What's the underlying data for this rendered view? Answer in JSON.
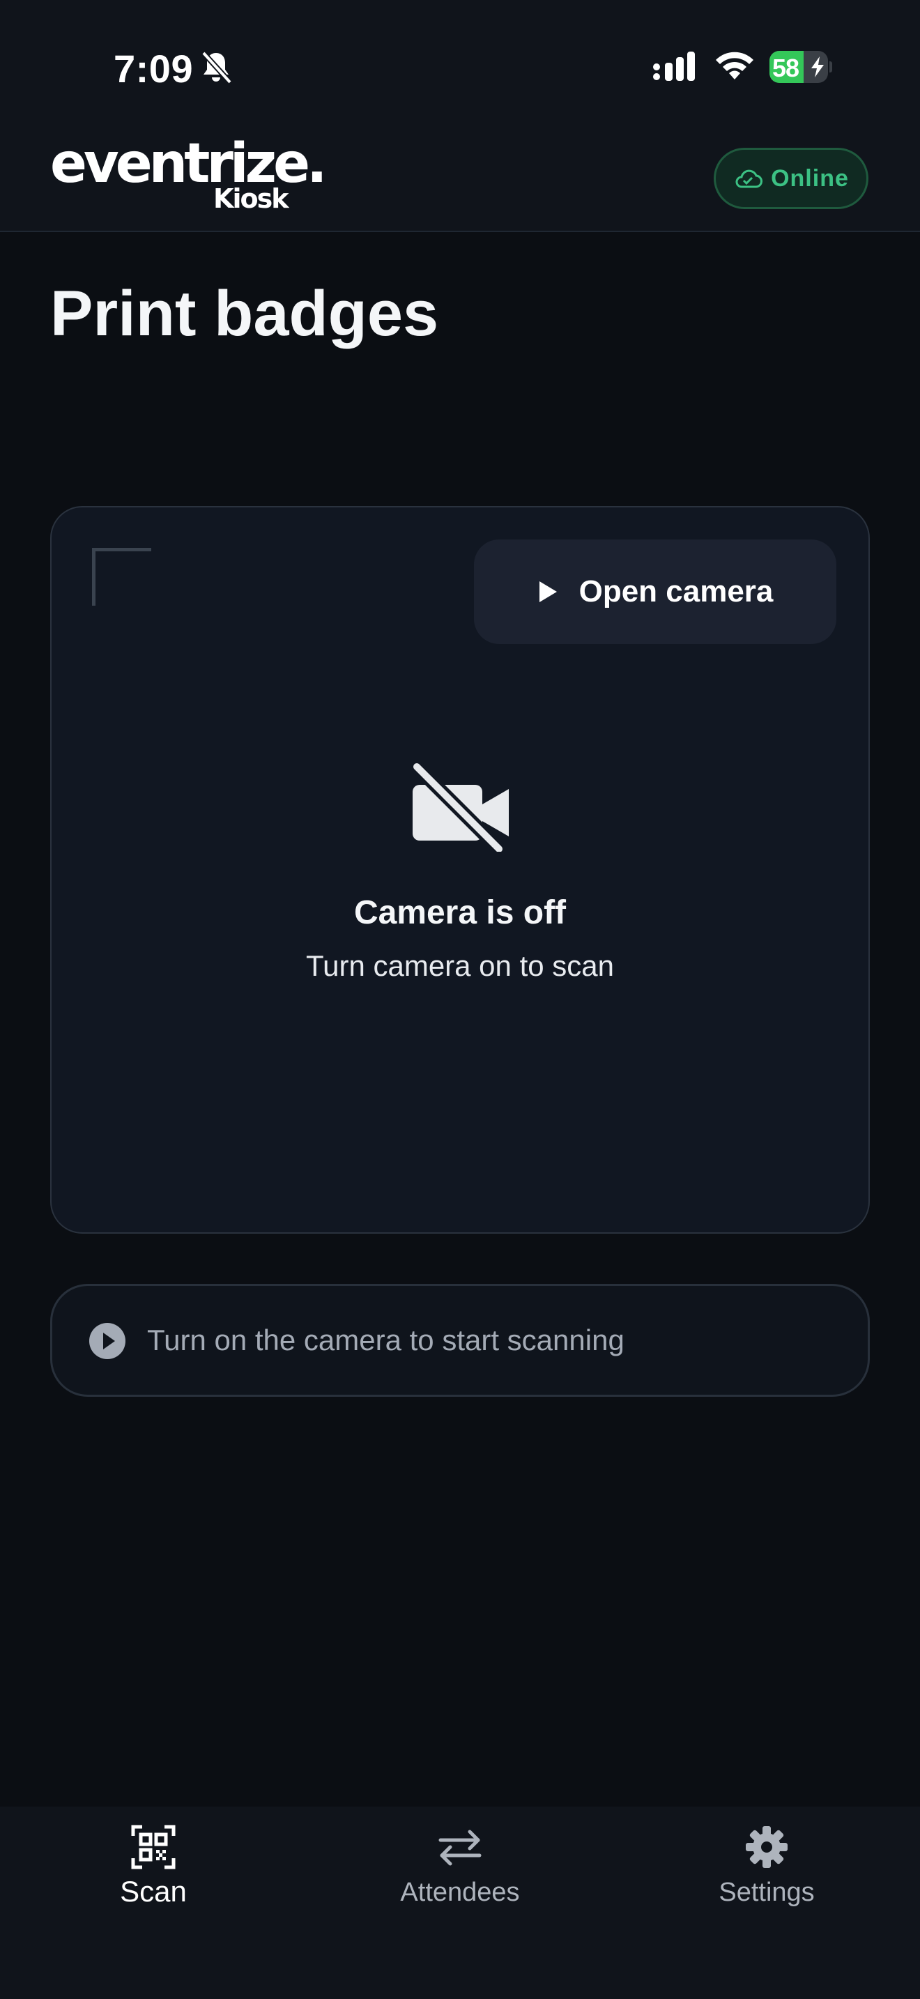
{
  "status_bar": {
    "time": "7:09",
    "battery_level": "58",
    "battery_fraction": 0.58
  },
  "header": {
    "logo_text": "eventrize.",
    "logo_subtext": "Kiosk",
    "connection_status": "Online",
    "status_color": "#3cc184"
  },
  "page": {
    "title": "Print badges"
  },
  "camera": {
    "open_button_label": "Open camera",
    "off_title": "Camera is off",
    "off_subtitle": "Turn camera on to scan"
  },
  "info_bar": {
    "message": "Turn on the camera to start scanning",
    "icon": "play-circle-icon"
  },
  "bottom_nav": {
    "items": [
      {
        "label": "Scan",
        "icon": "qr-code-icon",
        "active": true
      },
      {
        "label": "Attendees",
        "icon": "swap-arrows-icon",
        "active": false
      },
      {
        "label": "Settings",
        "icon": "gear-icon",
        "active": false
      }
    ]
  }
}
